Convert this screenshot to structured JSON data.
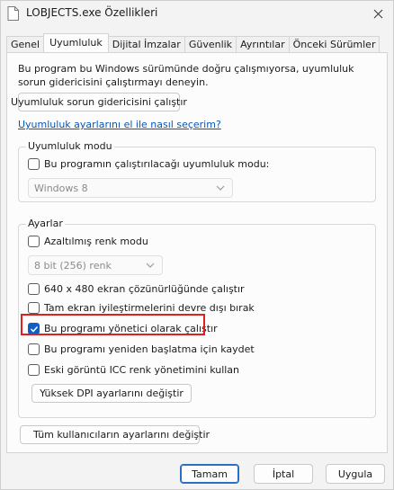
{
  "window": {
    "title": "LOBJECTS.exe Özellikleri"
  },
  "tabs": [
    {
      "label": "Genel"
    },
    {
      "label": "Uyumluluk"
    },
    {
      "label": "Dijital İmzalar"
    },
    {
      "label": "Güvenlik"
    },
    {
      "label": "Ayrıntılar"
    },
    {
      "label": "Önceki Sürümler"
    }
  ],
  "compat": {
    "description": "Bu program bu Windows sürümünde doğru çalışmıyorsa, uyumluluk sorun gidericisini çalıştırmayı deneyin.",
    "troubleshooter_button": "Uyumluluk sorun gidericisini çalıştır",
    "manual_link": "Uyumluluk ayarlarını el ile nasıl seçerim?"
  },
  "mode_group": {
    "title": "Uyumluluk modu",
    "checkbox_label": "Bu programın çalıştırılacağı uyumluluk modu:",
    "checked": false,
    "select_value": "Windows 8"
  },
  "settings_group": {
    "title": "Ayarlar",
    "reduced_color": {
      "label": "Azaltılmış renk modu",
      "checked": false
    },
    "color_select_value": "8 bit (256) renk",
    "res_640": {
      "label": "640 x 480 ekran çözünürlüğünde çalıştır",
      "checked": false
    },
    "fullscreen_opt": {
      "label": "Tam ekran iyileştirmelerini devre dışı bırak",
      "checked": false
    },
    "run_as_admin": {
      "label": "Bu programı yönetici olarak çalıştır",
      "checked": true
    },
    "register_restart": {
      "label": "Bu programı yeniden başlatma için kaydet",
      "checked": false
    },
    "legacy_icc": {
      "label": "Eski görüntü ICC renk yönetimini kullan",
      "checked": false
    },
    "dpi_button": "Yüksek DPI ayarlarını değiştir"
  },
  "all_users_button": "Tüm kullanıcıların ayarlarını değiştir",
  "footer": {
    "ok": "Tamam",
    "cancel": "İptal",
    "apply": "Uygula"
  },
  "colors": {
    "accent": "#0b5fc6",
    "highlight": "#e02020",
    "link": "#0a56b4"
  }
}
